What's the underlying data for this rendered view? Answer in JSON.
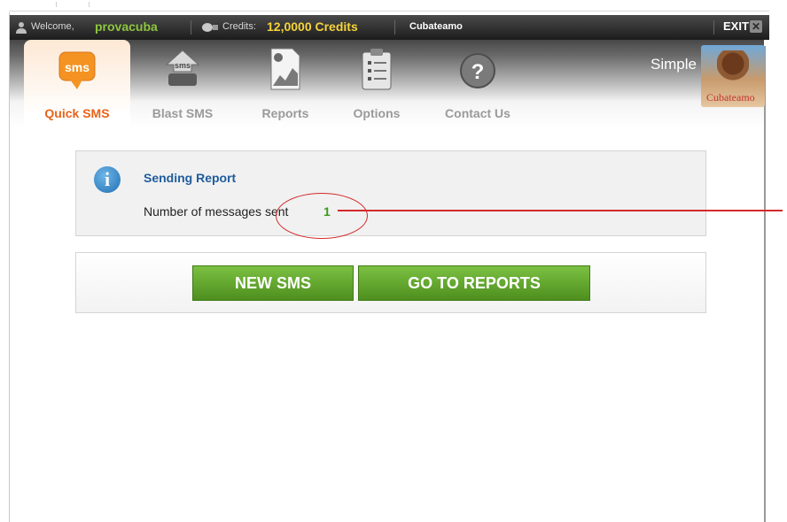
{
  "topbar": {
    "welcome_label": "Welcome,",
    "username": "provacuba",
    "credits_label": "Credits:",
    "credits_value": "12,0000 Credits",
    "site_name": "Cubateamo",
    "exit_label": "EXIT",
    "exit_icon_glyph": "✕"
  },
  "nav": {
    "tabs": [
      {
        "label": "Quick SMS",
        "icon": "sms-bubble-icon",
        "active": true
      },
      {
        "label": "Blast SMS",
        "icon": "sms-upload-icon",
        "active": false
      },
      {
        "label": "Reports",
        "icon": "report-document-icon",
        "active": false
      },
      {
        "label": "Options",
        "icon": "clipboard-icon",
        "active": false
      },
      {
        "label": "Contact Us",
        "icon": "question-icon",
        "active": false
      }
    ],
    "sms_icon_text": "sms",
    "blast_icon_text": "sms",
    "contact_icon_text": "?",
    "simple_text": "Simple",
    "logo_text": "Cubateamo"
  },
  "report": {
    "info_glyph": "i",
    "title": "Sending Report",
    "line_label": "Number of messages sent",
    "count": "1"
  },
  "buttons": {
    "new_sms": "NEW SMS",
    "go_to_reports": "GO TO REPORTS"
  },
  "colors": {
    "username": "#8dc63f",
    "credits": "#f7d33a",
    "active_tab": "#e8631a",
    "button_green": "#5fa52b",
    "annotation": "#d42a2a"
  }
}
